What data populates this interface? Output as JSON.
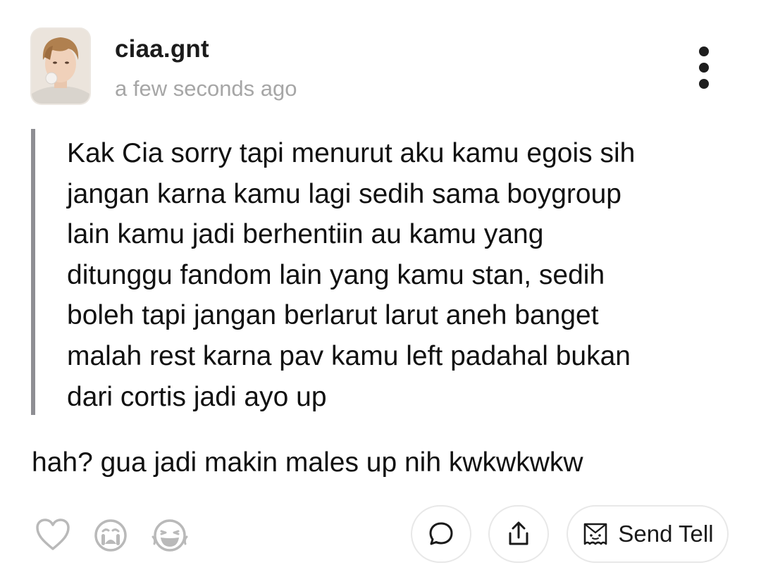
{
  "post": {
    "username": "ciaa.gnt",
    "timestamp": "a few seconds ago",
    "quoted_message": "Kak Cia sorry tapi menurut aku kamu egois sih\njangan karna kamu lagi sedih sama boygroup\nlain kamu jadi berhentiin au kamu yang\nditunggu fandom lain yang kamu stan, sedih\nboleh tapi jangan berlarut larut aneh banget\nmalah rest karna pav kamu left padahal bukan\ndari cortis jadi ayo up",
    "reply": "hah? gua jadi makin males up nih kwkwkwkw"
  },
  "actions": {
    "send_tell_label": "Send Tell"
  },
  "icons": {
    "heart": "heart-icon",
    "crying": "crying-face-icon",
    "laughing": "laughing-face-icon",
    "comment": "comment-bubble-icon",
    "share": "share-icon",
    "tell": "envelope-ghost-icon",
    "more": "vertical-dots-icon"
  },
  "colors": {
    "quote_bar": "#8e8e93",
    "timestamp": "#a6a6a6",
    "icon_gray": "#b9b9b9",
    "text": "#111111"
  }
}
